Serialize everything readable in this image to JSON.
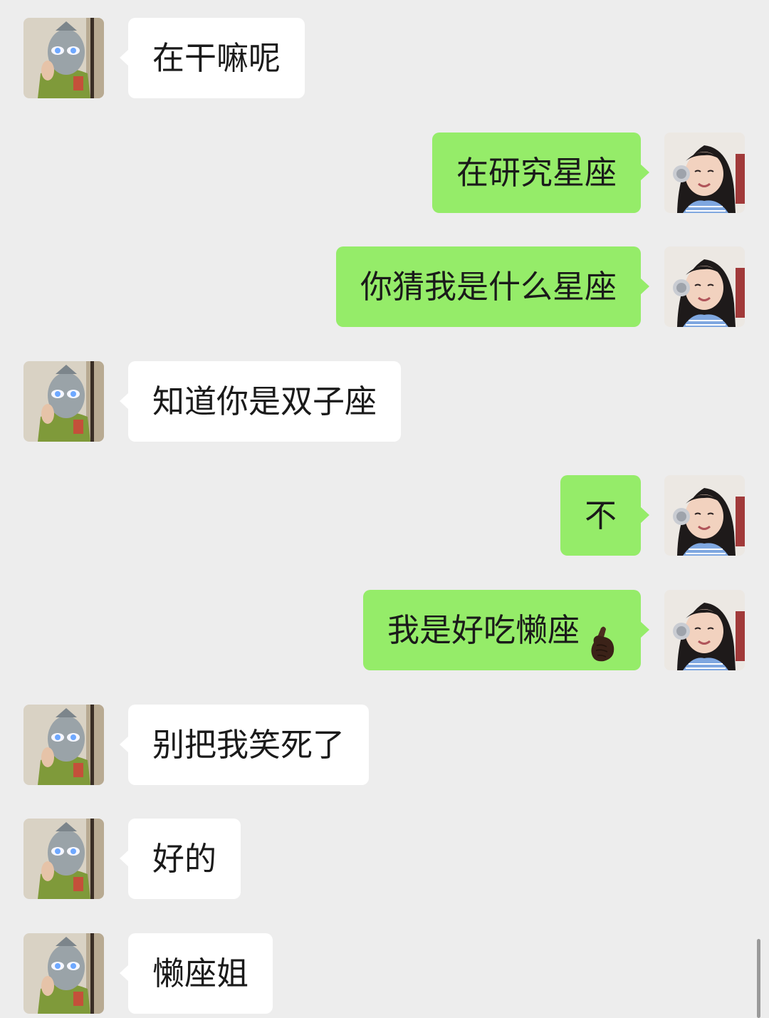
{
  "messages": [
    {
      "sender": "other",
      "text": "在干嘛呢"
    },
    {
      "sender": "me",
      "text": "在研究星座"
    },
    {
      "sender": "me",
      "text": "你猜我是什么星座"
    },
    {
      "sender": "other",
      "text": "知道你是双子座"
    },
    {
      "sender": "me",
      "text": "不"
    },
    {
      "sender": "me",
      "text": "我是好吃懒座",
      "emoji": "finger-heart-emoji"
    },
    {
      "sender": "other",
      "text": "别把我笑死了"
    },
    {
      "sender": "other",
      "text": "好的"
    },
    {
      "sender": "other",
      "text": "懒座姐"
    }
  ],
  "colors": {
    "background": "#ededed",
    "incoming_bubble": "#ffffff",
    "outgoing_bubble": "#95ec69",
    "text": "#1a1a1a"
  },
  "icons": {
    "other_avatar": "masked-hero-avatar-icon",
    "my_avatar": "girl-headphones-avatar-icon"
  }
}
